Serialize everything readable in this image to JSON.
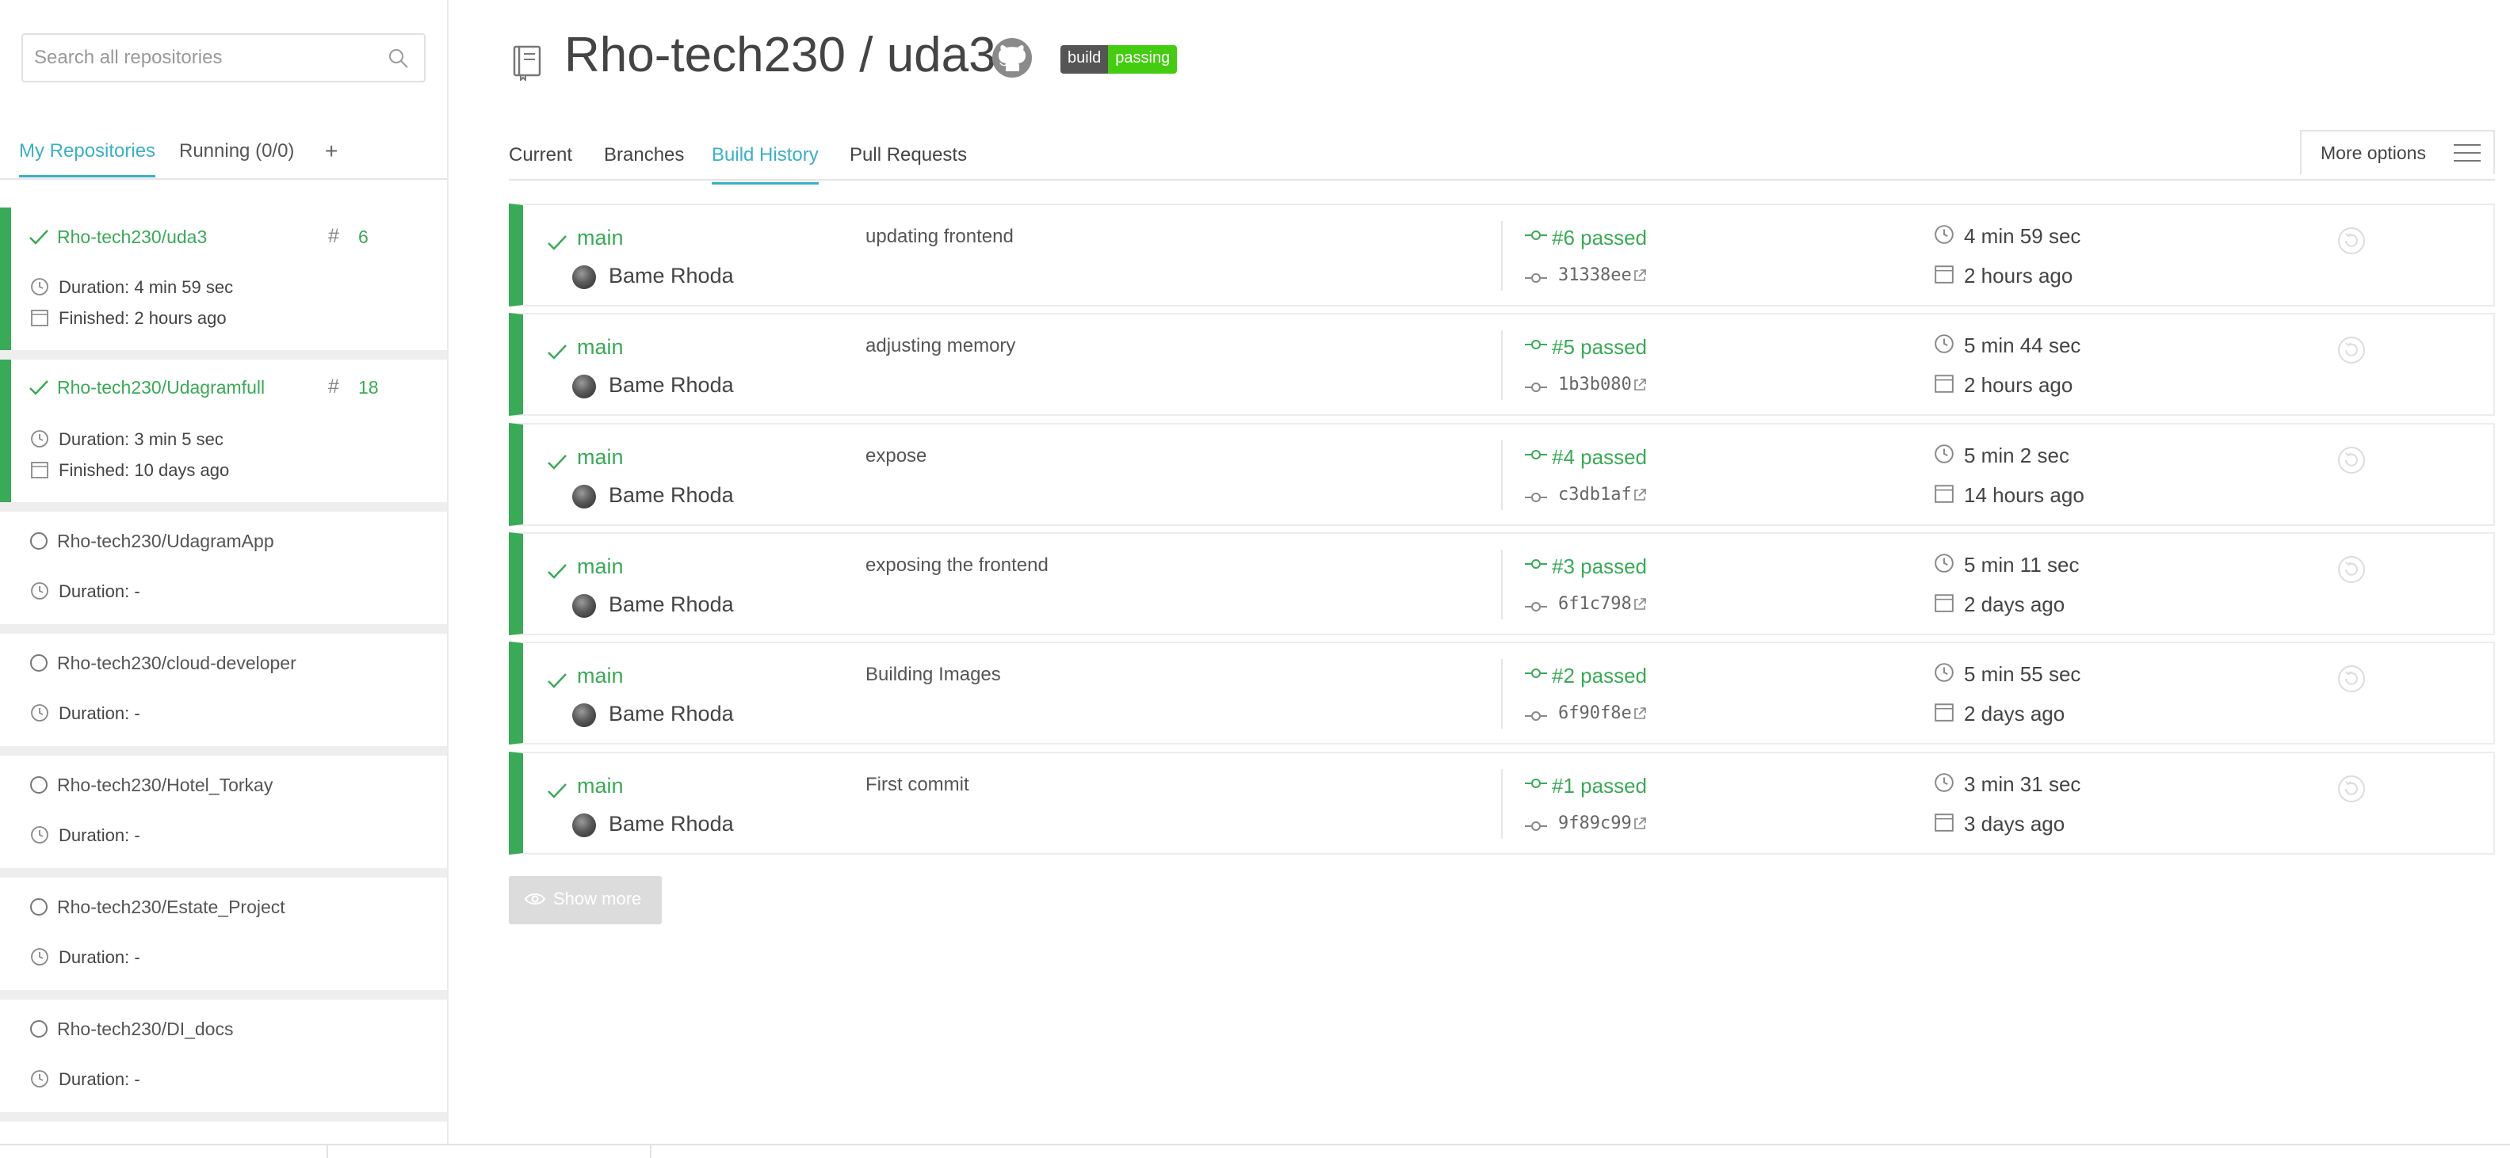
{
  "sidebar": {
    "search_placeholder": "Search all repositories",
    "tabs": [
      "My Repositories",
      "Running (0/0)",
      "+"
    ],
    "active_tab": "My Repositories",
    "repos": [
      {
        "name": "Rho-tech230/uda3",
        "status": "passed",
        "build_number": "6",
        "duration": "Duration: 4 min 59 sec",
        "finished": "Finished: 2 hours ago"
      },
      {
        "name": "Rho-tech230/Udagramfull",
        "status": "passed",
        "build_number": "18",
        "duration": "Duration: 3 min 5 sec",
        "finished": "Finished: 10 days ago"
      },
      {
        "name": "Rho-tech230/UdagramApp",
        "status": "none",
        "duration": "Duration: -"
      },
      {
        "name": "Rho-tech230/cloud-developer",
        "status": "none",
        "duration": "Duration: -"
      },
      {
        "name": "Rho-tech230/Hotel_Torkay",
        "status": "none",
        "duration": "Duration: -"
      },
      {
        "name": "Rho-tech230/Estate_Project",
        "status": "none",
        "duration": "Duration: -"
      },
      {
        "name": "Rho-tech230/DI_docs",
        "status": "none",
        "duration": "Duration: -"
      }
    ]
  },
  "header": {
    "repo_title": "Rho-tech230 / uda3",
    "badge_left": "build",
    "badge_right": "passing"
  },
  "tabs": {
    "items": [
      "Current",
      "Branches",
      "Build History",
      "Pull Requests"
    ],
    "active": "Build History",
    "more_options": "More options"
  },
  "builds": [
    {
      "branch": "main",
      "author": "Bame Rhoda",
      "message": "updating frontend",
      "status": "#6 passed",
      "commit": "31338ee",
      "duration": "4 min 59 sec",
      "finished": "2 hours ago"
    },
    {
      "branch": "main",
      "author": "Bame Rhoda",
      "message": "adjusting memory",
      "status": "#5 passed",
      "commit": "1b3b080",
      "duration": "5 min 44 sec",
      "finished": "2 hours ago"
    },
    {
      "branch": "main",
      "author": "Bame Rhoda",
      "message": "expose",
      "status": "#4 passed",
      "commit": "c3db1af",
      "duration": "5 min 2 sec",
      "finished": "14 hours ago"
    },
    {
      "branch": "main",
      "author": "Bame Rhoda",
      "message": "exposing the frontend",
      "status": "#3 passed",
      "commit": "6f1c798",
      "duration": "5 min 11 sec",
      "finished": "2 days ago"
    },
    {
      "branch": "main",
      "author": "Bame Rhoda",
      "message": "Building Images",
      "status": "#2 passed",
      "commit": "6f90f8e",
      "duration": "5 min 55 sec",
      "finished": "2 days ago"
    },
    {
      "branch": "main",
      "author": "Bame Rhoda",
      "message": "First commit",
      "status": "#1 passed",
      "commit": "9f89c99",
      "duration": "3 min 31 sec",
      "finished": "3 days ago"
    }
  ],
  "show_more": "Show more",
  "colors": {
    "passed": "#39aa56",
    "accent": "#3bb0c5",
    "badge_green": "#44cc11",
    "badge_dark": "#555555"
  }
}
